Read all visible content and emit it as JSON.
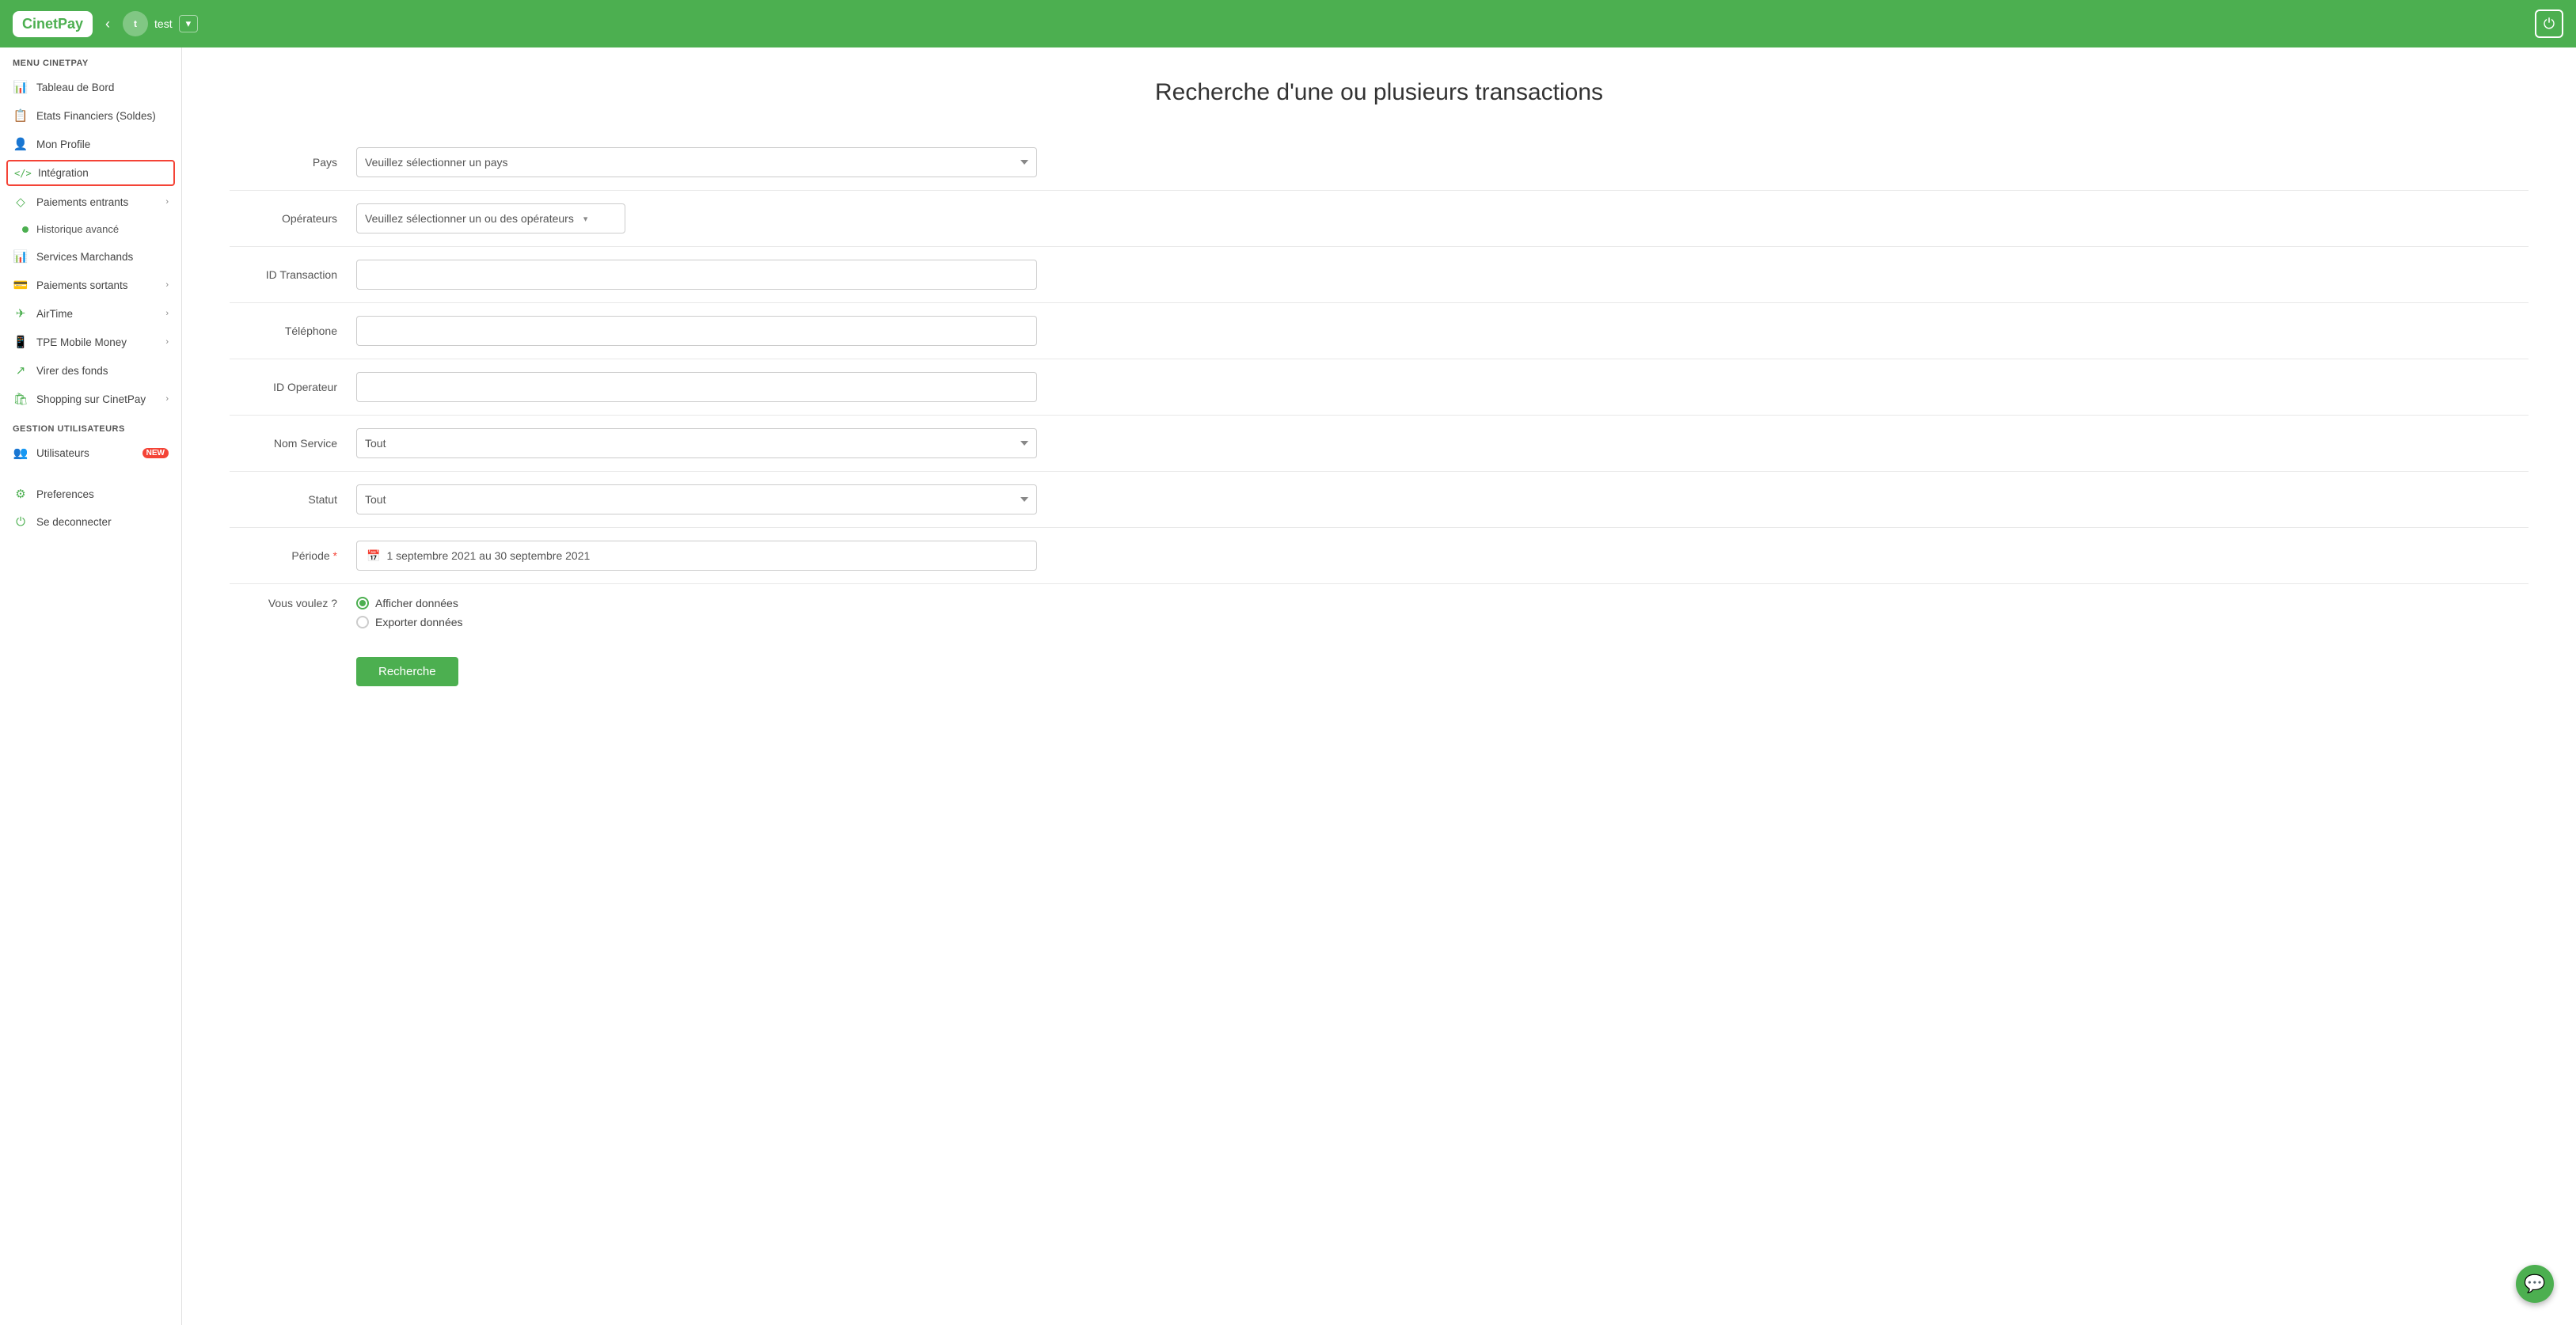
{
  "header": {
    "logo": "CinetPay",
    "account_name": "test",
    "power_icon": "⏻"
  },
  "sidebar": {
    "menu_label": "MENU CINETPAY",
    "items": [
      {
        "id": "tableau-de-bord",
        "label": "Tableau de Bord",
        "icon": "📊",
        "active": false
      },
      {
        "id": "etats-financiers",
        "label": "Etats Financiers (Soldes)",
        "icon": "📋",
        "active": false
      },
      {
        "id": "mon-profile",
        "label": "Mon Profile",
        "icon": "👤",
        "active": false
      },
      {
        "id": "integration",
        "label": "Intégration",
        "icon": "</>",
        "active": true
      },
      {
        "id": "paiements-entrants",
        "label": "Paiements entrants",
        "icon": "◇",
        "active": false,
        "chevron": true
      },
      {
        "id": "historique-avance",
        "label": "Historique avancé",
        "dot": true,
        "sub": true
      }
    ],
    "items2": [
      {
        "id": "services-marchands",
        "label": "Services Marchands",
        "icon": "📊"
      },
      {
        "id": "paiements-sortants",
        "label": "Paiements sortants",
        "icon": "💳",
        "chevron": true
      },
      {
        "id": "airtime",
        "label": "AirTime",
        "icon": "✈",
        "chevron": true
      },
      {
        "id": "tpe-mobile-money",
        "label": "TPE Mobile Money",
        "icon": "📱",
        "chevron": true
      },
      {
        "id": "virer-des-fonds",
        "label": "Virer des fonds",
        "icon": "↗"
      },
      {
        "id": "shopping",
        "label": "Shopping sur CinetPay",
        "icon": "🛍",
        "chevron": true
      }
    ],
    "gestion_label": "GESTION UTILISATEURS",
    "utilisateurs_label": "Utilisateurs",
    "bottom_items": [
      {
        "id": "preferences",
        "label": "Preferences",
        "icon": "⚙"
      },
      {
        "id": "se-deconnecter",
        "label": "Se deconnecter",
        "icon": "⏻"
      }
    ]
  },
  "form": {
    "title": "Recherche d'une ou plusieurs transactions",
    "fields": {
      "pays_label": "Pays",
      "pays_placeholder": "Veuillez sélectionner un pays",
      "operateurs_label": "Opérateurs",
      "operateurs_placeholder": "Veuillez sélectionner un ou des opérateurs",
      "id_transaction_label": "ID Transaction",
      "telephone_label": "Téléphone",
      "id_operateur_label": "ID Operateur",
      "nom_service_label": "Nom Service",
      "nom_service_value": "Tout",
      "statut_label": "Statut",
      "statut_value": "Tout",
      "periode_label": "Période",
      "periode_required": true,
      "periode_value": "1 septembre 2021 au 30 septembre 2021",
      "vous_voulez_label": "Vous voulez ?",
      "radio_afficher": "Afficher données",
      "radio_exporter": "Exporter données",
      "search_btn": "Recherche"
    }
  }
}
